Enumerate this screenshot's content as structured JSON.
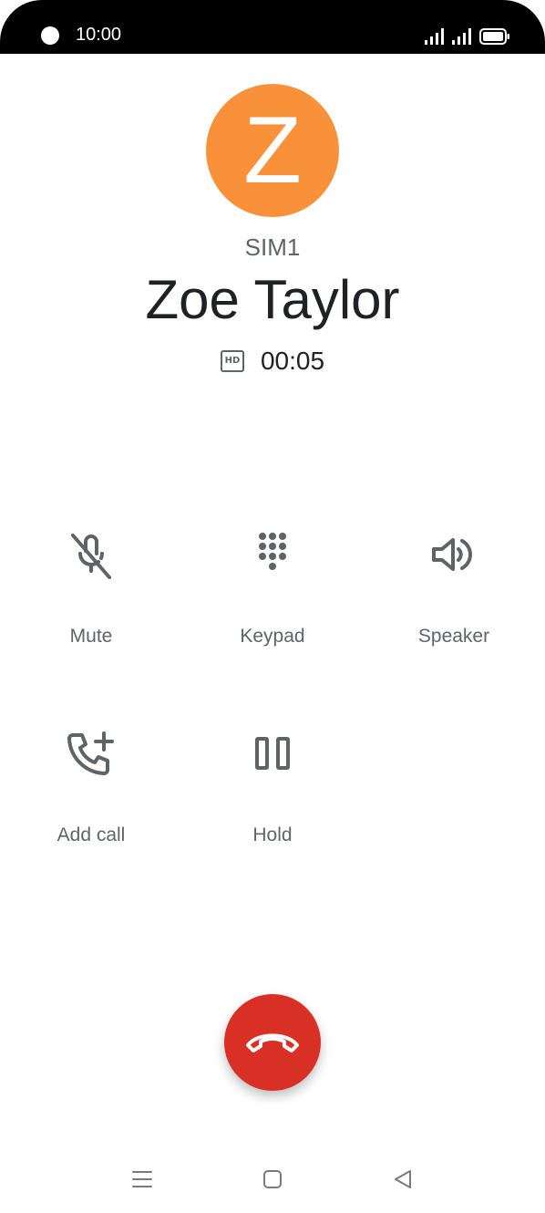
{
  "status_bar": {
    "time": "10:00",
    "icons": [
      "signal-icon",
      "signal-icon",
      "battery-icon"
    ]
  },
  "contact": {
    "avatar_letter": "Z",
    "avatar_color": "#f9913b",
    "sim": "SIM1",
    "name": "Zoe Taylor"
  },
  "call": {
    "hd_label": "HD",
    "duration": "00:05"
  },
  "actions": {
    "mute": "Mute",
    "keypad": "Keypad",
    "speaker": "Speaker",
    "add_call": "Add call",
    "hold": "Hold"
  },
  "end_call": {
    "icon": "hang-up-icon",
    "color": "#d93025"
  },
  "nav": {
    "icons": [
      "recents-icon",
      "home-icon",
      "back-icon"
    ]
  }
}
